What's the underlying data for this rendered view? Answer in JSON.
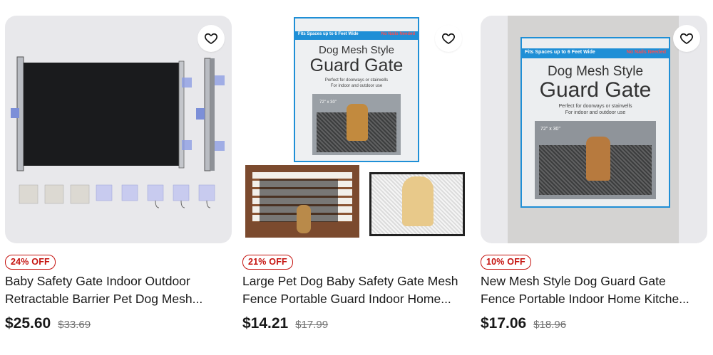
{
  "products": [
    {
      "badge": "24% OFF",
      "title": "Baby Safety Gate Indoor Outdoor Retractable Barrier Pet Dog Mesh...",
      "price": "$25.60",
      "original_price": "$33.69"
    },
    {
      "badge": "21% OFF",
      "title": "Large Pet Dog Baby Safety Gate Mesh Fence Portable Guard Indoor Home...",
      "price": "$14.21",
      "original_price": "$17.99",
      "box_art": {
        "tagline": "Fits Spaces up to 6 Feet Wide",
        "no_nails": "No Nails Needed",
        "line1": "Dog Mesh Style",
        "line2": "Guard Gate",
        "sub1": "Perfect for doorways or stairwells",
        "sub2": "For indoor and outdoor use",
        "size": "72\" x 30\""
      }
    },
    {
      "badge": "10% OFF",
      "title": "New Mesh Style Dog Guard Gate Fence Portable Indoor Home Kitche...",
      "price": "$17.06",
      "original_price": "$18.96",
      "box_art": {
        "tagline": "Fits Spaces up to 6 Feet Wide",
        "no_nails": "No Nails Needed",
        "line1": "Dog Mesh Style",
        "line2": "Guard Gate",
        "sub1": "Perfect for doorways or stairwells",
        "sub2": "For indoor and outdoor use",
        "size": "72\" x 30\""
      }
    }
  ],
  "colors": {
    "badge_red": "#c5130f",
    "image_bg": "#e8e8eb",
    "box_blue": "#1f8fd6"
  },
  "icons": [
    "heart-outline-icon"
  ]
}
